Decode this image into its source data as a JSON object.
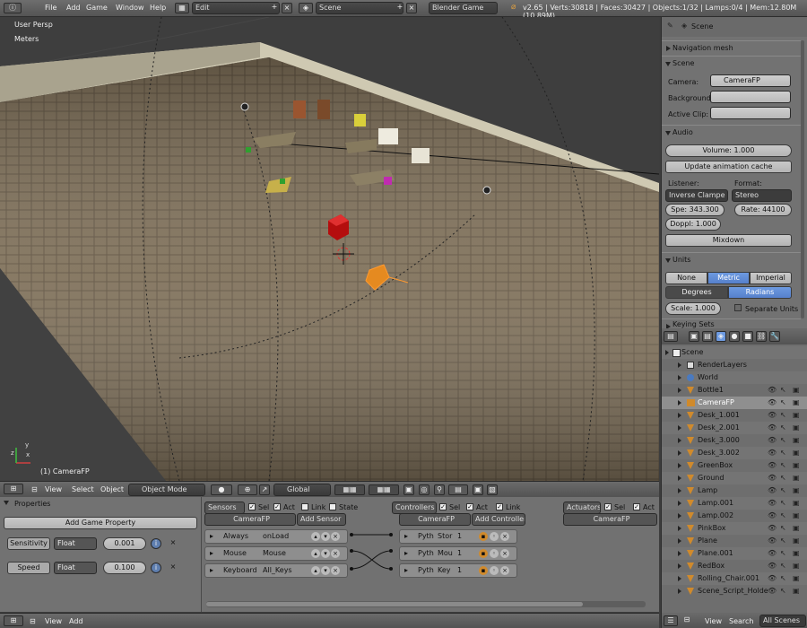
{
  "topbar": {
    "menu": [
      "File",
      "Add",
      "Game",
      "Window",
      "Help"
    ],
    "screen": "Edit",
    "scene": "Scene",
    "engine": "Blender Game",
    "stats": "v2.65 | Verts:30818 | Faces:30427 | Objects:1/32 | Lamps:0/4 | Mem:12.80M (10.89M)"
  },
  "viewport": {
    "view_name": "User Persp",
    "units": "Meters",
    "active_object": "(1) CameraFP",
    "floor_color": "#7a6a52",
    "wall_color": "#d4d0bc"
  },
  "vp_header": {
    "menu": [
      "View",
      "Select",
      "Object"
    ],
    "mode": "Object Mode",
    "orientation": "Global"
  },
  "props": {
    "context": "Scene",
    "nav_mesh": "Navigation mesh",
    "scene_panel": "Scene",
    "camera_label": "Camera:",
    "camera_value": "CameraFP",
    "background_label": "Background:",
    "clip_label": "Active Clip:",
    "audio_panel": "Audio",
    "volume": "Volume: 1.000",
    "update_cache": "Update animation cache",
    "listener_label": "Listener:",
    "format_label": "Format:",
    "listener_value": "Inverse Clampe",
    "format_value": "Stereo",
    "speed": "Spe: 343.300",
    "rate": "Rate: 44100",
    "doppler": "Doppl: 1.000",
    "mixdown": "Mixdown",
    "units_panel": "Units",
    "unit_none": "None",
    "unit_metric": "Metric",
    "unit_imperial": "Imperial",
    "degrees": "Degrees",
    "radians": "Radians",
    "scale": "Scale: 1.000",
    "separate_units": "Separate Units",
    "keying_sets": "Keying Sets"
  },
  "outliner": {
    "rows": [
      {
        "name": "Scene",
        "indent": 0,
        "kind": "scene"
      },
      {
        "name": "RenderLayers",
        "indent": 1,
        "kind": "render"
      },
      {
        "name": "World",
        "indent": 1,
        "kind": "world"
      },
      {
        "name": "Bottle1",
        "indent": 1,
        "kind": "mesh"
      },
      {
        "name": "CameraFP",
        "indent": 1,
        "kind": "camera"
      },
      {
        "name": "Desk_1.001",
        "indent": 1,
        "kind": "mesh"
      },
      {
        "name": "Desk_2.001",
        "indent": 1,
        "kind": "mesh"
      },
      {
        "name": "Desk_3.000",
        "indent": 1,
        "kind": "mesh"
      },
      {
        "name": "Desk_3.002",
        "indent": 1,
        "kind": "mesh"
      },
      {
        "name": "GreenBox",
        "indent": 1,
        "kind": "mesh"
      },
      {
        "name": "Ground",
        "indent": 1,
        "kind": "mesh"
      },
      {
        "name": "Lamp",
        "indent": 1,
        "kind": "lamp"
      },
      {
        "name": "Lamp.001",
        "indent": 1,
        "kind": "lamp"
      },
      {
        "name": "Lamp.002",
        "indent": 1,
        "kind": "lamp"
      },
      {
        "name": "PinkBox",
        "indent": 1,
        "kind": "mesh"
      },
      {
        "name": "Plane",
        "indent": 1,
        "kind": "mesh"
      },
      {
        "name": "Plane.001",
        "indent": 1,
        "kind": "mesh"
      },
      {
        "name": "RedBox",
        "indent": 1,
        "kind": "mesh"
      },
      {
        "name": "Rolling_Chair.001",
        "indent": 1,
        "kind": "mesh"
      },
      {
        "name": "Scene_Script_Holde",
        "indent": 1,
        "kind": "empty"
      }
    ],
    "footer": {
      "view": "View",
      "search": "Search",
      "scenes": "All Scenes"
    }
  },
  "logic": {
    "properties_title": "Properties",
    "add_game_property": "Add Game Property",
    "game_props": [
      {
        "name": "Sensitivity",
        "type": "Float",
        "value": "0.001"
      },
      {
        "name": "Speed",
        "type": "Float",
        "value": "0.100"
      }
    ],
    "sensors_label": "Sensors",
    "controllers_label": "Controllers",
    "actuators_label": "Actuators",
    "sel": "Sel",
    "act": "Act",
    "link": "Link",
    "state": "State",
    "object_name": "CameraFP",
    "add_sensor": "Add Sensor",
    "add_controller": "Add Controller",
    "sensors": [
      {
        "type": "Always",
        "name": "onLoad"
      },
      {
        "type": "Mouse",
        "name": "Mouse"
      },
      {
        "type": "Keyboard",
        "name": "All_Keys"
      }
    ],
    "controllers": [
      {
        "type": "Pyth",
        "name": "Stor",
        "num": "1"
      },
      {
        "type": "Pyth",
        "name": "Mou",
        "num": "1"
      },
      {
        "type": "Pyth",
        "name": "Key",
        "num": "1"
      }
    ]
  },
  "bottombar": {
    "menu": [
      "View",
      "Add"
    ]
  }
}
